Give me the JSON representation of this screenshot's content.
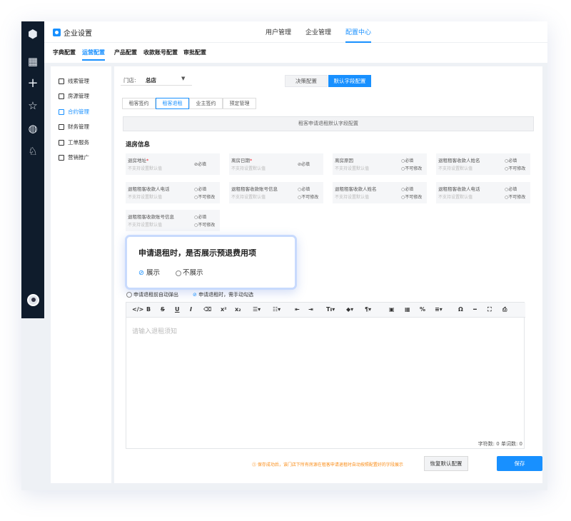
{
  "app": {
    "title": "企业设置"
  },
  "topnav": [
    "用户管理",
    "企业管理",
    "配置中心"
  ],
  "subnav": [
    "字典配置",
    "运营配置",
    "产品配置",
    "收款账号配置",
    "审批配置"
  ],
  "sidebar": [
    "线索管理",
    "房源管理",
    "合约管理",
    "财务管理",
    "工单服务",
    "营销推广"
  ],
  "store": {
    "label": "门店:",
    "value": "总店"
  },
  "toggle": {
    "a": "决策配置",
    "b": "默认字段配置"
  },
  "tabs": [
    "租客签约",
    "租客退租",
    "业主签约",
    "预定管理"
  ],
  "banner": "租客申请退租默认字段配置",
  "section_title": "退房信息",
  "fields": [
    {
      "name": "退房地址",
      "req": "*",
      "hint": "不支持设置默认值",
      "o1": "⊘必填",
      "o2": ""
    },
    {
      "name": "离房日期",
      "req": "*",
      "hint": "不支持设置默认值",
      "o1": "⊘必填",
      "o2": ""
    },
    {
      "name": "离房原因",
      "req": "",
      "hint": "不支持设置默认值",
      "o1": "○必填",
      "o2": "○不可修改"
    },
    {
      "name": "退租租客收款人姓名",
      "req": "",
      "hint": "不支持设置默认值",
      "o1": "○必填",
      "o2": "○不可修改"
    },
    {
      "name": "退租租客收款人电话",
      "req": "",
      "hint": "不支持设置默认值",
      "o1": "○必填",
      "o2": "○不可修改"
    },
    {
      "name": "退租租客收款账号信息",
      "req": "",
      "hint": "不支持设置默认值",
      "o1": "○必填",
      "o2": "○不可修改"
    },
    {
      "name": "退租租客收款人姓名",
      "req": "",
      "hint": "不支持设置默认值",
      "o1": "○必填",
      "o2": "○不可修改"
    },
    {
      "name": "退租租客收款人电话",
      "req": "",
      "hint": "不支持设置默认值",
      "o1": "○必填",
      "o2": "○不可修改"
    },
    {
      "name": "退租租客收款账号信息",
      "req": "",
      "hint": "不支持设置默认值",
      "o1": "○必填",
      "o2": "○不可修改"
    }
  ],
  "popup": {
    "question": "申请退租时，是否展示预退费用项",
    "opt1": "展示",
    "opt2": "不展示"
  },
  "radio": {
    "a": "申请退租前自动弹出",
    "b": "申请退租时，需手动勾选"
  },
  "editor": {
    "placeholder": "请输入退租须知",
    "counts": "字符数: 0  单词数: 0"
  },
  "hint": "⓵ 保存成功后，该门店下所有房源在租客申请退租时自动按照配置好的字段展示",
  "buttons": {
    "reset": "恢复默认配置",
    "save": "保存"
  }
}
